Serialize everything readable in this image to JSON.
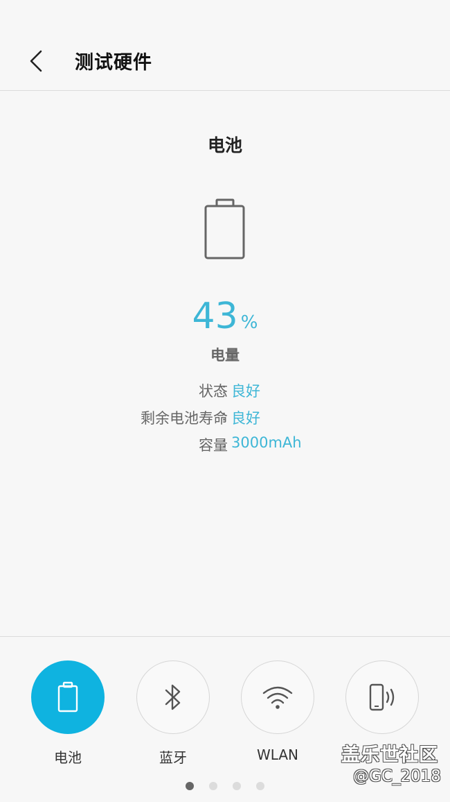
{
  "header": {
    "title": "测试硬件",
    "back_icon": "chevron-left-icon"
  },
  "main": {
    "section_title": "电池",
    "battery_icon": "battery-outline-icon",
    "level_value": "43",
    "level_unit": "%",
    "level_label": "电量",
    "info": [
      {
        "key": "状态",
        "sep": ":",
        "value": "良好"
      },
      {
        "key": "剩余电池寿命",
        "sep": ":",
        "value": "良好"
      },
      {
        "key": "容量",
        "sep": ":",
        "value": "3000mAh"
      }
    ],
    "accent_color": "#3db6d6"
  },
  "tabs": [
    {
      "label": "电池",
      "icon": "battery-icon",
      "active": true
    },
    {
      "label": "蓝牙",
      "icon": "bluetooth-icon",
      "active": false
    },
    {
      "label": "WLAN",
      "icon": "wifi-icon",
      "active": false
    },
    {
      "label": "",
      "icon": "phone-vibrate-icon",
      "active": false
    }
  ],
  "pagination": {
    "pages": 4,
    "current": 1
  },
  "watermark": {
    "line1": "盖乐世社区",
    "line2": "@GC_2018"
  },
  "colors": {
    "active_tab": "#0fb3e0",
    "background": "#f7f7f7"
  }
}
